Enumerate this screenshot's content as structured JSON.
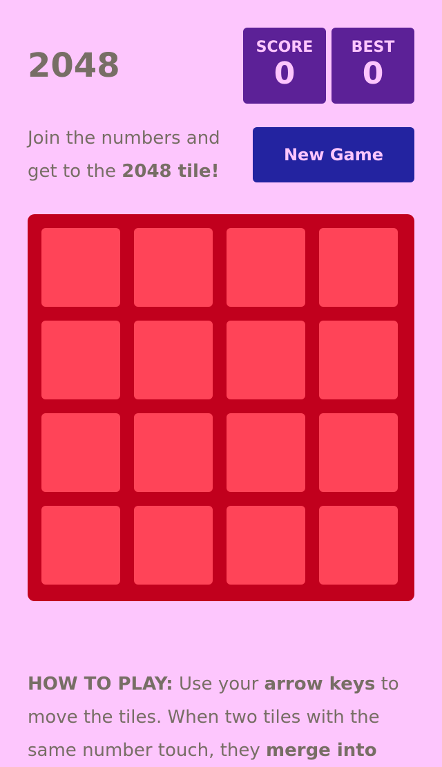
{
  "game": {
    "title": "2048"
  },
  "scores": {
    "score_label": "SCORE",
    "score_value": "0",
    "best_label": "BEST",
    "best_value": "0"
  },
  "intro": {
    "text": "Join the numbers and get to the ",
    "highlight": "2048 tile!"
  },
  "controls": {
    "new_game_label": "New Game"
  },
  "board": {
    "size": 4,
    "cells": [
      [
        "",
        "",
        "",
        ""
      ],
      [
        "",
        "",
        "",
        ""
      ],
      [
        "",
        "",
        "",
        ""
      ],
      [
        "",
        "",
        "",
        ""
      ]
    ]
  },
  "how_to_play": {
    "label": "HOW TO PLAY:",
    "text_1": " Use your ",
    "bold_1": "arrow keys",
    "text_2": " to move the tiles. When two tiles with the same number touch, they ",
    "bold_2": "merge into"
  },
  "colors": {
    "background": "#fdc6fd",
    "board": "#c1001d",
    "empty_cell": "#ff4458",
    "score_box": "#5c2197",
    "new_game_button": "#2323a0",
    "text": "#776e65"
  }
}
